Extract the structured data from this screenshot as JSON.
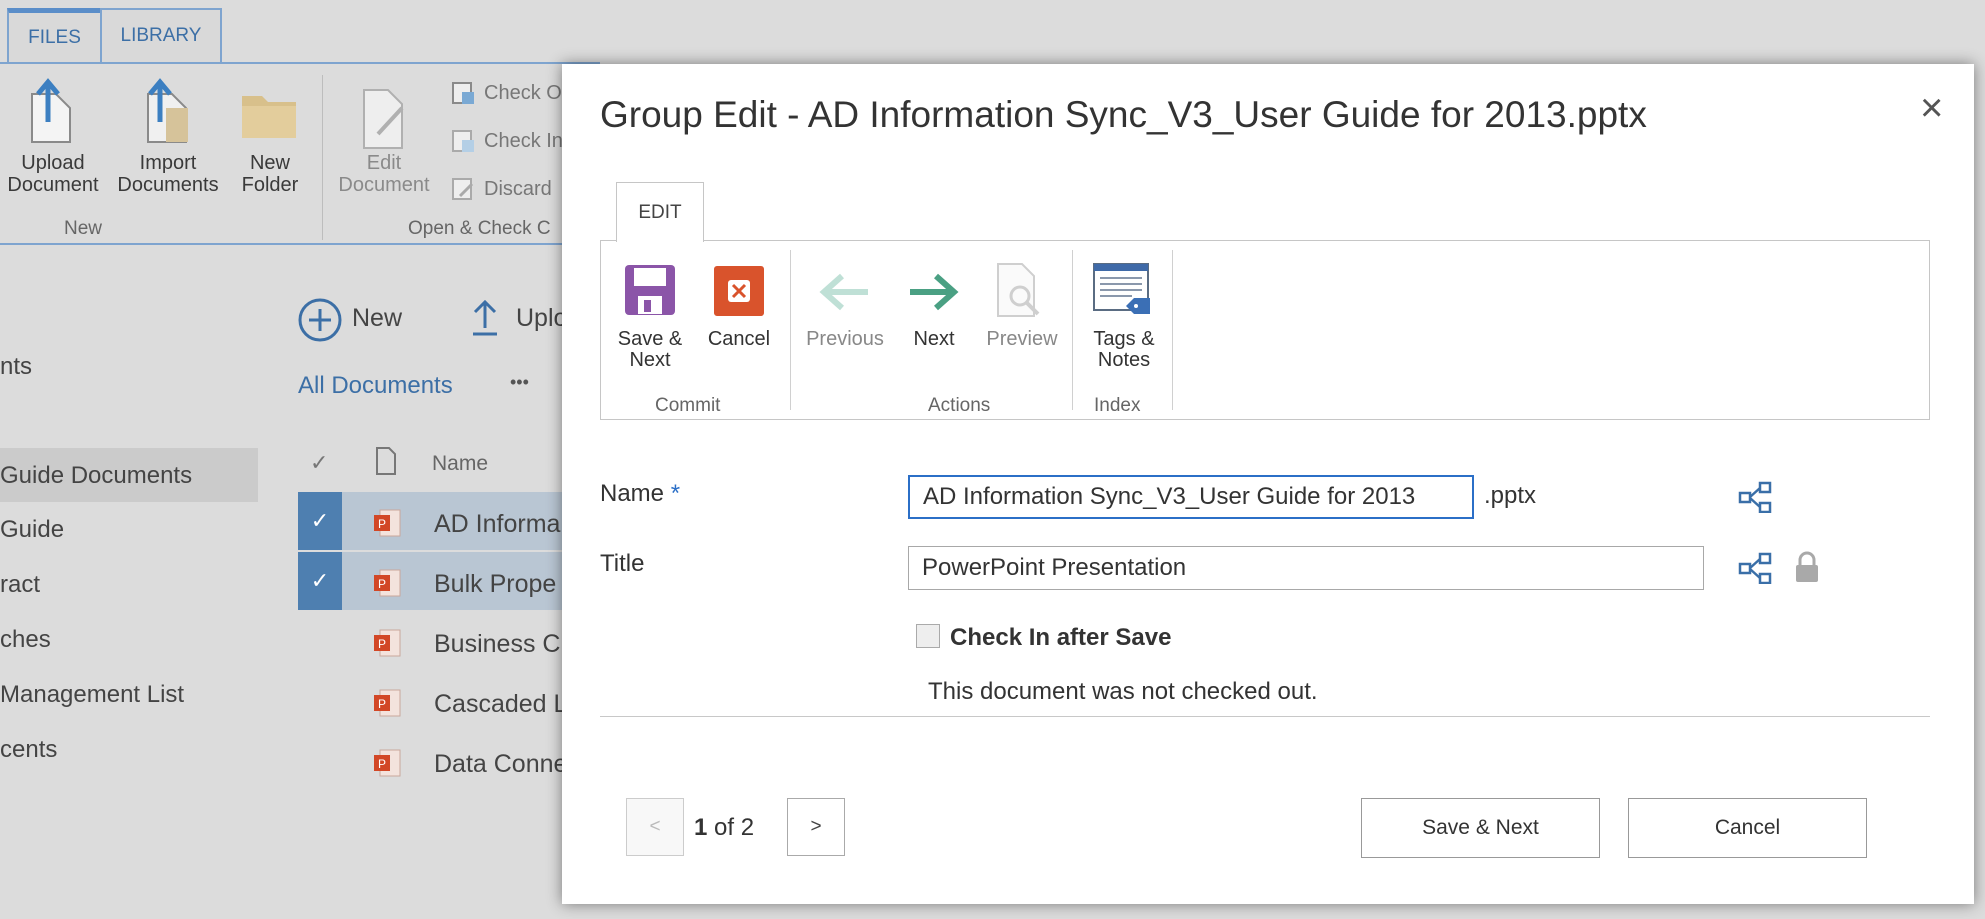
{
  "background": {
    "tabs": [
      {
        "label": "FILES"
      },
      {
        "label": "LIBRARY"
      }
    ],
    "ribbon": {
      "upload": "Upload Document",
      "upload_l1": "Upload",
      "upload_l2": "Document",
      "import_l1": "Import",
      "import_l2": "Documents",
      "newfolder_l1": "New",
      "newfolder_l2": "Folder",
      "edit_l1": "Edit",
      "edit_l2": "Document",
      "checkout": "Check O",
      "checkin": "Check In",
      "discard": "Discard",
      "group_new": "New",
      "group_open": "Open & Check C"
    },
    "sidebar": {
      "items": [
        {
          "label": "nts"
        },
        {
          "label": "Guide Documents"
        },
        {
          "label": "Guide"
        },
        {
          "label": "ract"
        },
        {
          "label": "ches"
        },
        {
          "label": "Management List"
        },
        {
          "label": "cents"
        }
      ]
    },
    "commands": {
      "new": "New",
      "upload": "Uplo"
    },
    "view": {
      "all_documents": "All Documents",
      "more": "•••"
    },
    "list": {
      "name_header": "Name",
      "rows": [
        {
          "name": "AD Informa",
          "selected": true
        },
        {
          "name": "Bulk Prope",
          "selected": true
        },
        {
          "name": "Business Ch",
          "selected": false
        },
        {
          "name": "Cascaded L",
          "selected": false
        },
        {
          "name": "Data Conne",
          "selected": false
        }
      ]
    }
  },
  "dialog": {
    "title": "Group Edit - AD Information Sync_V3_User Guide for 2013.pptx",
    "close": "×",
    "tab": "EDIT",
    "ribbon": {
      "save_l1": "Save &",
      "save_l2": "Next",
      "cancel": "Cancel",
      "previous": "Previous",
      "next": "Next",
      "preview": "Preview",
      "tags_l1": "Tags &",
      "tags_l2": "Notes",
      "group_commit": "Commit",
      "group_actions": "Actions",
      "group_index": "Index"
    },
    "fields": {
      "name_label": "Name",
      "required_mark": "*",
      "name_value": "AD Information Sync_V3_User Guide for 2013",
      "extension": ".pptx",
      "title_label": "Title",
      "title_value": "PowerPoint Presentation"
    },
    "checkin": {
      "label": "Check In after Save",
      "checked": false,
      "note": "This document was not checked out."
    },
    "pager": {
      "prev": "<",
      "current": "1",
      "of_text": "of 2",
      "next": ">"
    },
    "buttons": {
      "save_next": "Save & Next",
      "cancel": "Cancel"
    },
    "colors": {
      "save_icon": "#8b55a8",
      "cancel_icon": "#d9532c",
      "next_arrow": "#4aa083",
      "prev_arrow": "#bfe0d6",
      "share_icon": "#3a6fa8",
      "input_focus": "#2b6fc7",
      "required": "#2b6fc7"
    }
  }
}
